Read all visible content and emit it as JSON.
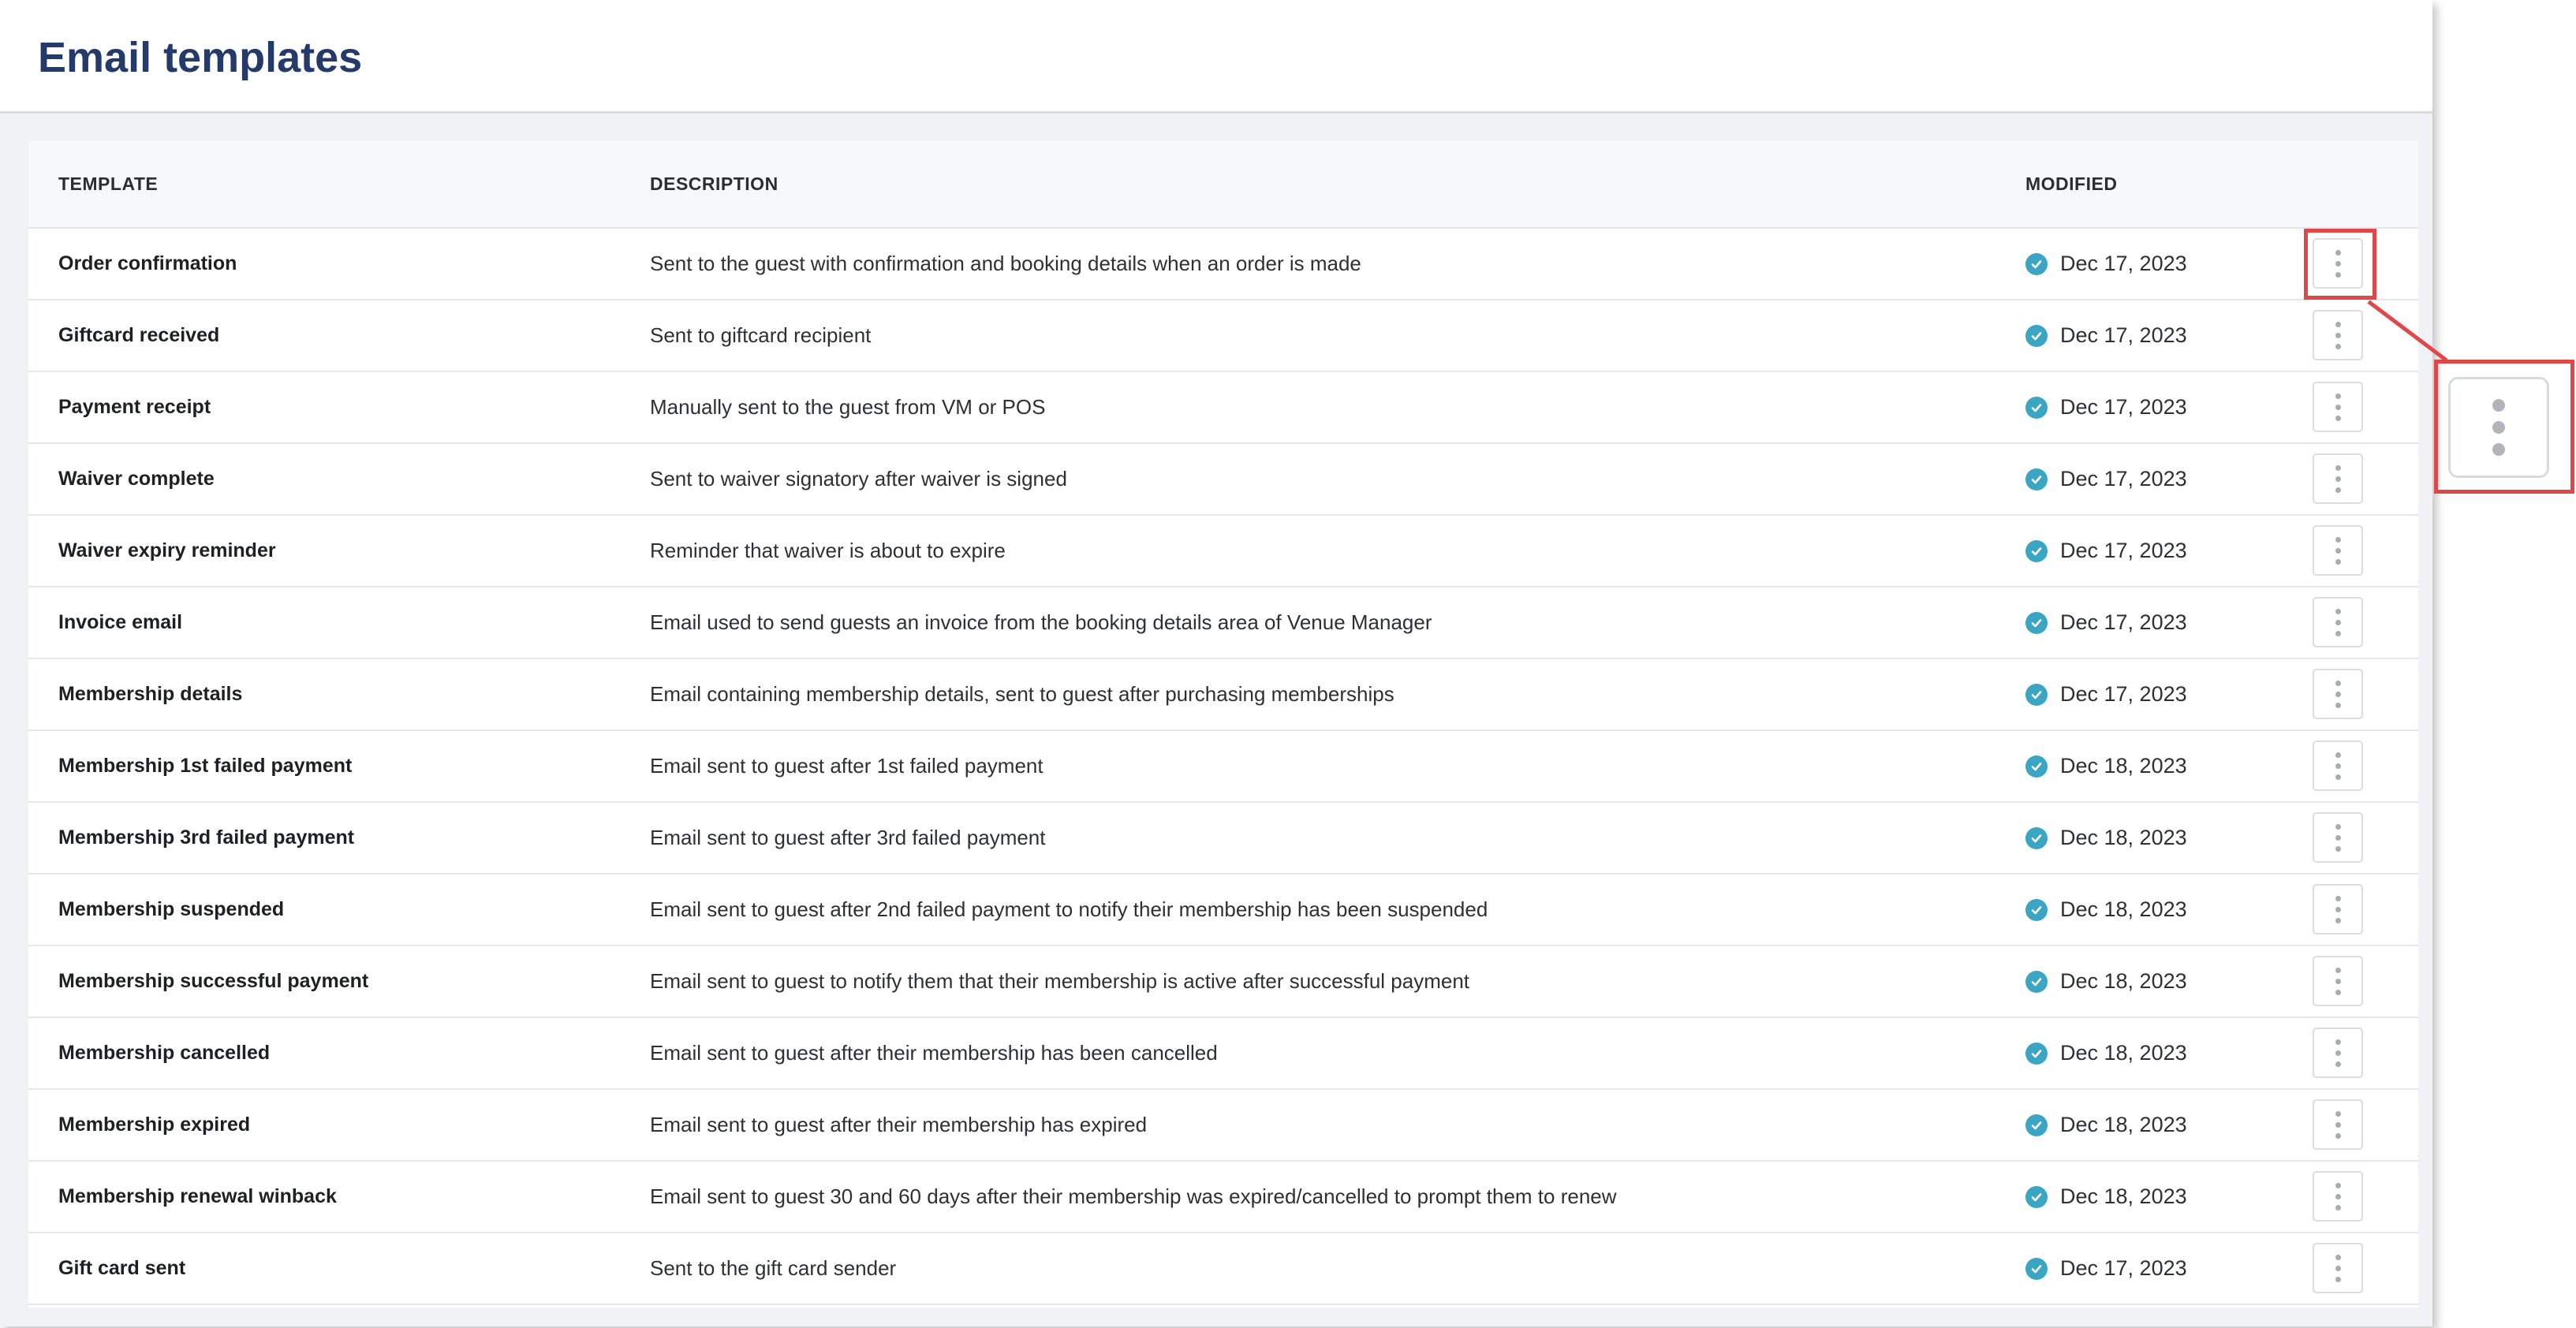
{
  "page": {
    "title": "Email templates"
  },
  "table": {
    "headers": {
      "template": "TEMPLATE",
      "description": "DESCRIPTION",
      "modified": "MODIFIED"
    },
    "rows": [
      {
        "name": "Order confirmation",
        "description": "Sent to the guest with confirmation and booking details when an order is made",
        "modified": "Dec 17, 2023"
      },
      {
        "name": "Giftcard received",
        "description": "Sent to giftcard recipient",
        "modified": "Dec 17, 2023"
      },
      {
        "name": "Payment receipt",
        "description": "Manually sent to the guest from VM or POS",
        "modified": "Dec 17, 2023"
      },
      {
        "name": "Waiver complete",
        "description": "Sent to waiver signatory after waiver is signed",
        "modified": "Dec 17, 2023"
      },
      {
        "name": "Waiver expiry reminder",
        "description": "Reminder that waiver is about to expire",
        "modified": "Dec 17, 2023"
      },
      {
        "name": "Invoice email",
        "description": "Email used to send guests an invoice from the booking details area of Venue Manager",
        "modified": "Dec 17, 2023"
      },
      {
        "name": "Membership details",
        "description": "Email containing membership details, sent to guest after purchasing memberships",
        "modified": "Dec 17, 2023"
      },
      {
        "name": "Membership 1st failed payment",
        "description": "Email sent to guest after 1st failed payment",
        "modified": "Dec 18, 2023"
      },
      {
        "name": "Membership 3rd failed payment",
        "description": "Email sent to guest after 3rd failed payment",
        "modified": "Dec 18, 2023"
      },
      {
        "name": "Membership suspended",
        "description": "Email sent to guest after 2nd failed payment to notify their membership has been suspended",
        "modified": "Dec 18, 2023"
      },
      {
        "name": "Membership successful payment",
        "description": "Email sent to guest to notify them that their membership is active after successful payment",
        "modified": "Dec 18, 2023"
      },
      {
        "name": "Membership cancelled",
        "description": "Email sent to guest after their membership has been cancelled",
        "modified": "Dec 18, 2023"
      },
      {
        "name": "Membership expired",
        "description": "Email sent to guest after their membership has expired",
        "modified": "Dec 18, 2023"
      },
      {
        "name": "Membership renewal winback",
        "description": "Email sent to guest 30 and 60 days after their membership was expired/cancelled to prompt them to renew",
        "modified": "Dec 18, 2023"
      },
      {
        "name": "Gift card sent",
        "description": "Sent to the gift card sender",
        "modified": "Dec 17, 2023"
      }
    ]
  },
  "icons": {
    "status": "check-circle-icon",
    "row_actions": "kebab-menu-icon"
  },
  "colors": {
    "title": "#233a6a",
    "status_check": "#3ba6c4",
    "callout": "#e04848"
  }
}
